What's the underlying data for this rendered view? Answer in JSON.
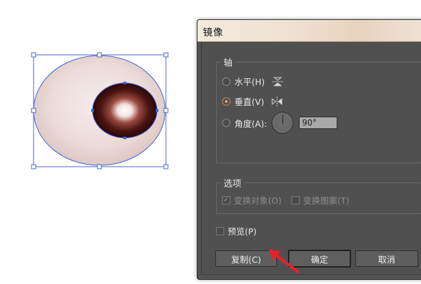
{
  "dialog": {
    "title": "镜像",
    "axis_group": {
      "label": "轴",
      "horizontal_label": "水平(H)",
      "vertical_label": "垂直(V)",
      "angle_label": "角度(A):",
      "angle_value": "90°",
      "selected": "vertical"
    },
    "options_group": {
      "label": "选项",
      "transform_objects_label": "变换对象(O)",
      "transform_objects_checked": true,
      "transform_patterns_label": "变换图案(T)",
      "transform_patterns_checked": false
    },
    "preview_label": "预览(P)",
    "preview_checked": false,
    "buttons": {
      "copy_label": "复制(C)",
      "ok_label": "确定",
      "cancel_label": "取消"
    }
  },
  "colors": {
    "dialog_bg": "#535353",
    "selection_blue": "#3f63d9",
    "annotation_red": "#e8202a",
    "radio_accent": "#f0a060"
  },
  "icons": [
    "reflect-horizontal-icon",
    "reflect-vertical-icon",
    "angle-dial-icon",
    "checkmark-icon",
    "red-arrow-icon"
  ]
}
